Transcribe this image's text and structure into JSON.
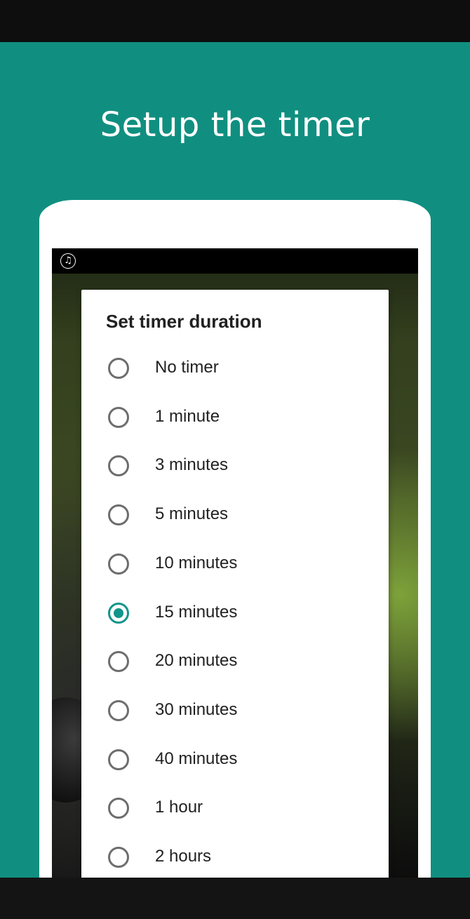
{
  "promo": {
    "title": "Setup the timer"
  },
  "dialog": {
    "title": "Set timer duration",
    "options": [
      {
        "label": "No timer",
        "checked": false
      },
      {
        "label": "1 minute",
        "checked": false
      },
      {
        "label": "3 minutes",
        "checked": false
      },
      {
        "label": "5 minutes",
        "checked": false
      },
      {
        "label": "10 minutes",
        "checked": false
      },
      {
        "label": "15 minutes",
        "checked": true
      },
      {
        "label": "20 minutes",
        "checked": false
      },
      {
        "label": "30 minutes",
        "checked": false
      },
      {
        "label": "40 minutes",
        "checked": false
      },
      {
        "label": "1 hour",
        "checked": false
      },
      {
        "label": "2 hours",
        "checked": false
      }
    ]
  },
  "status_bar": {
    "icon": "music-note-icon"
  },
  "colors": {
    "background": "#108f80",
    "accent": "#11958a"
  }
}
